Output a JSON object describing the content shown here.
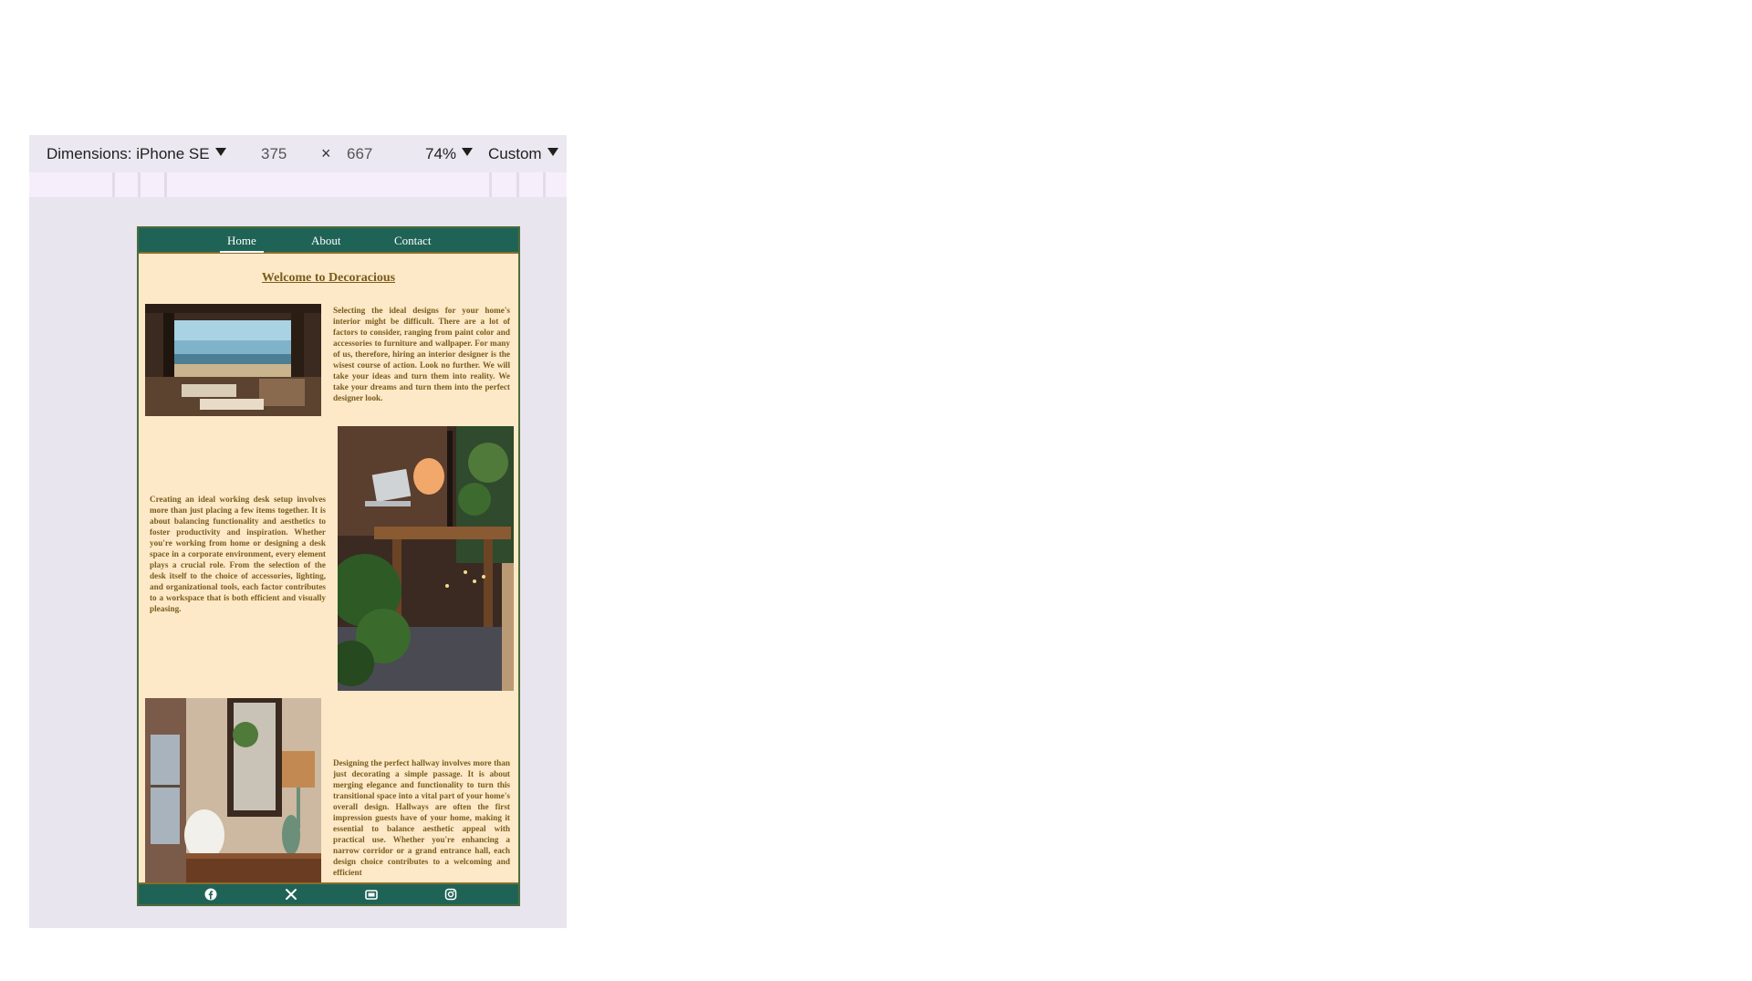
{
  "devtools": {
    "dimensions_label": "Dimensions: iPhone SE",
    "width": "375",
    "times": "×",
    "height": "667",
    "zoom": "74%",
    "throttle": "Custom"
  },
  "site": {
    "nav": [
      "Home",
      "About",
      "Contact"
    ],
    "welcome": "Welcome to Decoracious",
    "paragraphs": [
      "Selecting the ideal designs for your home's interior might be difficult. There are a lot of factors to consider, ranging from paint color and accessories to furniture and wallpaper. For many of us, therefore, hiring an interior designer is the wisest course of action. Look no further. We will take your ideas and turn them into reality. We take your dreams and turn them into the perfect designer look.",
      "Creating an ideal working desk setup involves more than just placing a few items together. It is about balancing functionality and aesthetics to foster productivity and inspiration. Whether you're working from home or designing a desk space in a corporate environment, every element plays a crucial role. From the selection of the desk itself to the choice of accessories, lighting, and organizational tools, each factor contributes to a workspace that is both efficient and visually pleasing.",
      "Designing the perfect hallway involves more than just decorating a simple passage. It is about merging elegance and functionality to turn this transitional space into a vital part of your home's overall design. Hallways are often the first impression guests have of your home, making it essential to balance aesthetic appeal with practical use. Whether you're enhancing a narrow corridor or a grand entrance hall, each design choice contributes to a welcoming and efficient"
    ],
    "footer_icons": [
      "facebook-icon",
      "x-icon",
      "youtube-icon",
      "instagram-icon"
    ]
  }
}
